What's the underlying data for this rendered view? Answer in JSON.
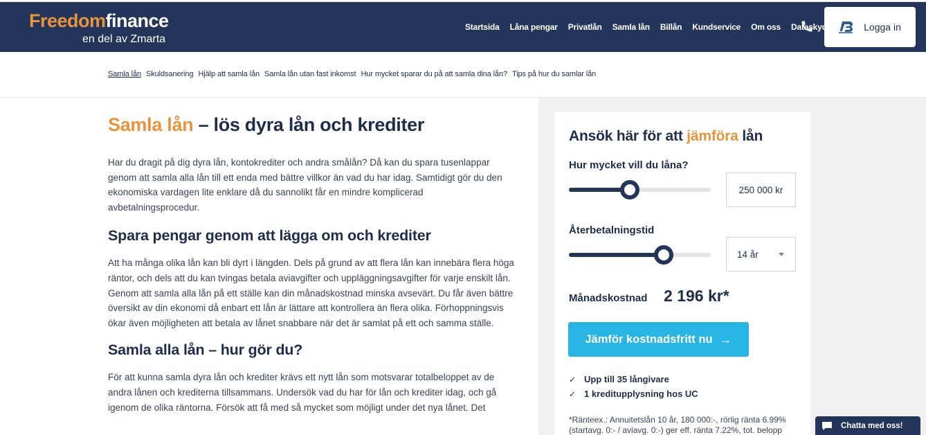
{
  "header": {
    "logo": {
      "part1": "Freedom",
      "part2": "finance",
      "subtitle": "en del av Zmarta"
    },
    "nav": [
      "Startsida",
      "Låna pengar",
      "Privatlån",
      "Samla lån",
      "Billån",
      "Kundservice",
      "Om oss",
      "Dataskydd"
    ],
    "phone_icon": "phone-icon",
    "login_label": "Logga in",
    "login_icon": "bankid-icon"
  },
  "subnav": [
    "Samla lån",
    "Skuldsanering",
    "Hjälp att samla lån",
    "Samla lån utan fast inkomst",
    "Hur mycket sparar du på att samla dina lån?",
    "Tips på hur du samlar lån"
  ],
  "article": {
    "title_accent": "Samla lån",
    "title_rest": " – lös dyra lån och krediter",
    "p1": "Har du dragit på dig dyra lån, kontokrediter och andra smålån? Då kan du spara tusenlappar genom att samla alla lån till ett enda med bättre villkor än vad du har idag. Samtidigt gör du den ekonomiska vardagen lite enklare då du sannolikt får en mindre komplicerad avbetalningsprocedur.",
    "h2a": "Spara pengar genom att lägga om och krediter",
    "p2": "Att ha många olika lån kan bli dyrt i längden. Dels på grund av att flera lån kan innebära flera höga räntor, och dels att du kan tvingas betala aviavgifter och uppläggningsavgifter för varje enskilt lån. Genom att samla alla lån på ett ställe kan din månadskostnad minska avsevärt. Du får även bättre översikt av din ekonomi då enbart ett lån är lättare att kontrollera än flera olika. Förhoppningsvis ökar även möjligheten att betala av lånet snabbare när det är samlat på ett och samma ställe.",
    "h2b": "Samla alla lån – hur gör du?",
    "p3": "För att kunna samla dyra lån och krediter krävs ett nytt lån som motsvarar totalbeloppet av de andra lånen och krediterna tillsammans. Undersök vad du har för lån och krediter idag, och gå igenom de olika räntorna. Försök att få med så mycket som möjligt under det nya lånet. Det"
  },
  "calculator": {
    "title_pre": "Ansök här för att ",
    "title_accent": "jämföra",
    "title_post": " lån",
    "amount_label": "Hur mycket vill du låna?",
    "amount_value": "250 000 kr",
    "amount_slider_fraction": 0.43,
    "term_label": "Återbetalningstid",
    "term_value": "14 år",
    "term_slider_fraction": 0.67,
    "monthly_label": "Månadskostnad",
    "monthly_value": "2 196 kr*",
    "cta_label": "Jämför kostnadsfritt nu",
    "checks": [
      "Upp till 35 långivare",
      "1 kreditupplysning hos UC"
    ],
    "footnote": "*Ränteex.: Annuitetslån 10 år, 180 000:-, rörlig ränta 6.99% (startavg. 0:- / aviavg. 0:-) ger eff. ränta 7.22%, tot. belopp"
  },
  "chat": {
    "label": "Chatta med oss!"
  },
  "colors": {
    "navy": "#24355b",
    "orange": "#e8943a",
    "cta": "#27b5e6"
  }
}
